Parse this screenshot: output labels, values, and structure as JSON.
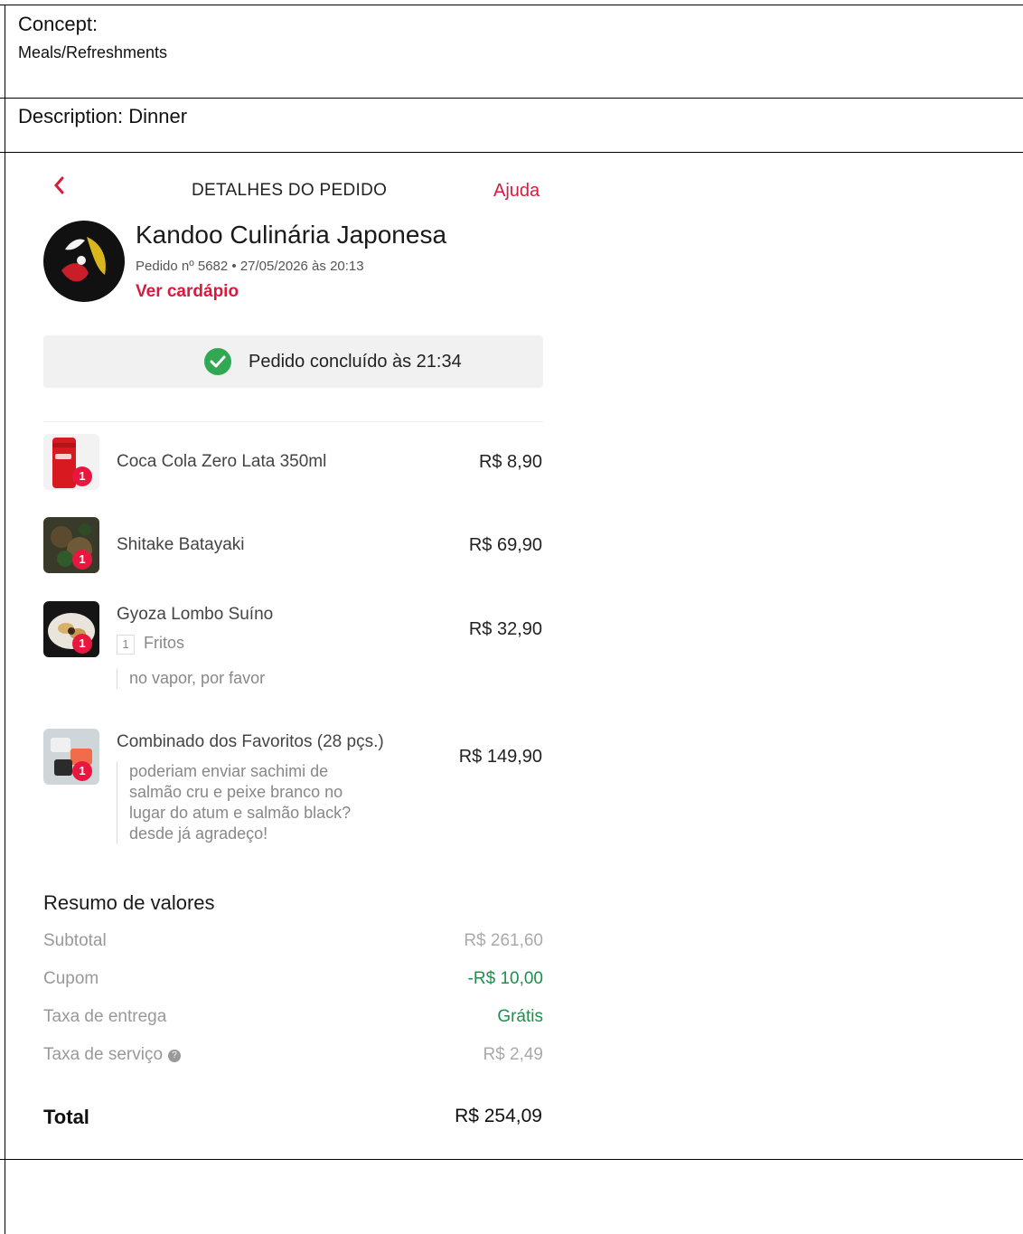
{
  "form": {
    "concept_label": "Concept:",
    "concept_value": "Meals/Refreshments",
    "description": "Description: Dinner"
  },
  "header": {
    "back_icon": "chevron-left-icon",
    "title": "DETALHES DO PEDIDO",
    "help_label": "Ajuda"
  },
  "store": {
    "name": "Kandoo Culinária Japonesa",
    "order_info": "Pedido nº 5682 • 27/05/2026 às 20:13",
    "menu_link": "Ver cardápio"
  },
  "status": {
    "icon": "check-circle-icon",
    "text": "Pedido concluído às 21:34"
  },
  "items": [
    {
      "name": "Coca Cola Zero Lata 350ml",
      "price": "R$ 8,90",
      "qty": "1"
    },
    {
      "name": "Shitake Batayaki",
      "price": "R$ 69,90",
      "qty": "1"
    },
    {
      "name": "Gyoza Lombo Suíno",
      "price": "R$ 32,90",
      "qty": "1",
      "option_qty": "1",
      "option": "Fritos",
      "note": "no vapor, por favor"
    },
    {
      "name": "Combinado dos Favoritos (28 pçs.)",
      "price": "R$ 149,90",
      "qty": "1",
      "note_lines": [
        "poderiam enviar sachimi de",
        "salmão cru e peixe branco no",
        "lugar do atum e salmão black?",
        "desde já agradeço!"
      ]
    }
  ],
  "summary": {
    "title": "Resumo de valores",
    "subtotal_label": "Subtotal",
    "subtotal_value": "R$ 261,60",
    "coupon_label": "Cupom",
    "coupon_value": "-R$ 10,00",
    "delivery_label": "Taxa de entrega",
    "delivery_value": "Grátis",
    "service_label": "Taxa de serviço",
    "service_value": "R$ 2,49",
    "total_label": "Total",
    "total_value": "R$ 254,09"
  },
  "colors": {
    "accent": "#d61b3c",
    "success": "#33a853",
    "discount": "#1e8e4e"
  }
}
